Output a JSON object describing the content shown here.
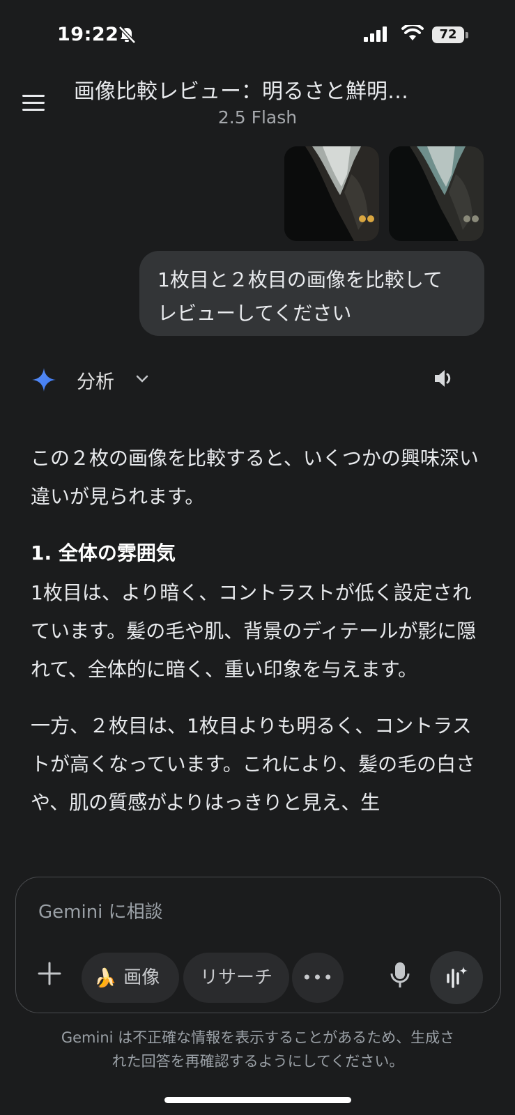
{
  "status_bar": {
    "time": "19:22",
    "battery": "72",
    "icons": [
      "bell-off-icon",
      "signal-icon",
      "wifi-icon",
      "battery-icon"
    ]
  },
  "header": {
    "title": "画像比較レビュー：明るさと鮮明…",
    "model": "2.5 Flash"
  },
  "user_message": {
    "text": "1枚目と２枚目の画像を比較してレビューしてください",
    "line1": "1枚目と２枚目の画像を比較して",
    "line2": "レビューしてください"
  },
  "response": {
    "mode_label": "分析",
    "intro": "この２枚の画像を比較すると、いくつかの興味深い違いが見られます。",
    "section1_heading": "1. 全体の雰囲気",
    "section1_p1": "1枚目は、より暗く、コントラストが低く設定されています。髪の毛や肌、背景のディテールが影に隠れて、全体的に暗く、重い印象を与えます。",
    "section1_p2": "一方、２枚目は、1枚目よりも明るく、コントラストが高くなっています。これにより、髪の毛の白さや、肌の質感がよりはっきりと見え、生"
  },
  "composer": {
    "placeholder": "Gemini に相談",
    "chip_image_emoji": "🍌",
    "chip_image": "画像",
    "chip_research": "リサーチ",
    "chip_more": "•••"
  },
  "footer": {
    "disclaimer_line1": "Gemini は不正確な情報を表示することがあるため、生成さ",
    "disclaimer_line2": "れた回答を再確認するようにしてください。"
  },
  "colors": {
    "background": "#1b1c1d",
    "bubble": "#333537",
    "chip": "#2a2b2d",
    "gemini_blue": "#4c8df6"
  }
}
